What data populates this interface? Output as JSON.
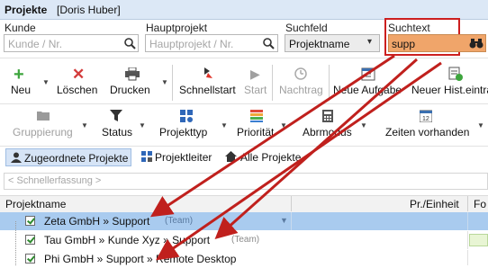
{
  "window": {
    "title": "Projekte",
    "user": "[Doris Huber]"
  },
  "filters": {
    "kunde_label": "Kunde",
    "kunde_placeholder": "Kunde / Nr.",
    "hauptprojekt_label": "Hauptprojekt",
    "hauptprojekt_placeholder": "Hauptprojekt / Nr.",
    "suchfeld_label": "Suchfeld",
    "suchfeld_value": "Projektname",
    "suchtext_label": "Suchtext",
    "suchtext_value": "supp"
  },
  "toolbar1": {
    "neu": "Neu",
    "loeschen": "Löschen",
    "drucken": "Drucken",
    "schnellstart": "Schnellstart",
    "start": "Start",
    "nachtrag": "Nachtrag",
    "neue_aufgabe": "Neue Aufgabe",
    "neuer_hist": "Neuer Hist.eintra"
  },
  "toolbar2": {
    "gruppierung": "Gruppierung",
    "status": "Status",
    "projekttyp": "Projekttyp",
    "prioritaet": "Priorität",
    "abrmodus": "Abrmodus",
    "zeiten": "Zeiten vorhanden"
  },
  "tabs": {
    "zugeordnete": "Zugeordnete Projekte",
    "projektleiter": "Projektleiter",
    "alle": "Alle Projekte"
  },
  "quickentry_placeholder": "< Schnellerfassung >",
  "table": {
    "col_projektname": "Projektname",
    "col_pr_einheit": "Pr./Einheit",
    "col_fo": "Fo",
    "rows": [
      {
        "name": "Zeta GmbH » Support",
        "badge": "(Team)",
        "checked": true,
        "selected": true
      },
      {
        "name": "Tau GmbH » Kunde Xyz » Support",
        "badge": "(Team)",
        "checked": true,
        "selected": false
      },
      {
        "name": "Phi GmbH » Support » Remote Desktop",
        "badge": "",
        "checked": true,
        "selected": false
      }
    ]
  },
  "colors": {
    "highlight": "#cc1f1f",
    "search_bg": "#f0a56a",
    "selected_row": "#a9cbef",
    "arrow": "#c0201d"
  }
}
